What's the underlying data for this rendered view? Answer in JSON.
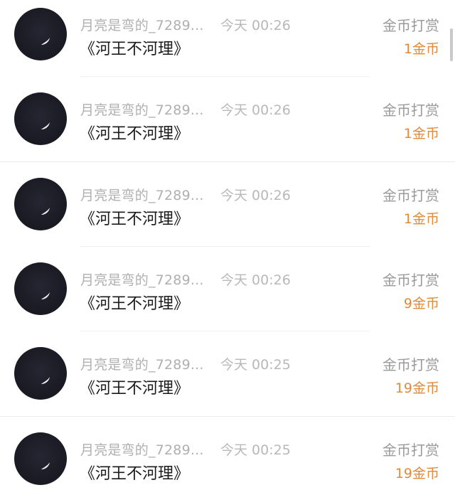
{
  "records": [
    {
      "user": "月亮是弯的_7289...",
      "time": "今天 00:26",
      "book": "《河王不河理》",
      "type": "金币打赏",
      "amount": "1金币"
    },
    {
      "user": "月亮是弯的_7289...",
      "time": "今天 00:26",
      "book": "《河王不河理》",
      "type": "金币打赏",
      "amount": "1金币"
    },
    {
      "user": "月亮是弯的_7289...",
      "time": "今天 00:26",
      "book": "《河王不河理》",
      "type": "金币打赏",
      "amount": "1金币"
    },
    {
      "user": "月亮是弯的_7289...",
      "time": "今天 00:26",
      "book": "《河王不河理》",
      "type": "金币打赏",
      "amount": "9金币"
    },
    {
      "user": "月亮是弯的_7289...",
      "time": "今天 00:25",
      "book": "《河王不河理》",
      "type": "金币打赏",
      "amount": "19金币"
    },
    {
      "user": "月亮是弯的_7289...",
      "time": "今天 00:25",
      "book": "《河王不河理》",
      "type": "金币打赏",
      "amount": "19金币"
    }
  ],
  "icons": {
    "avatar": "moon-avatar-icon"
  },
  "colors": {
    "amount": "#e08a3a",
    "name": "#b0b0b0",
    "title": "#1a1a1a",
    "type": "#9a9a9a"
  }
}
